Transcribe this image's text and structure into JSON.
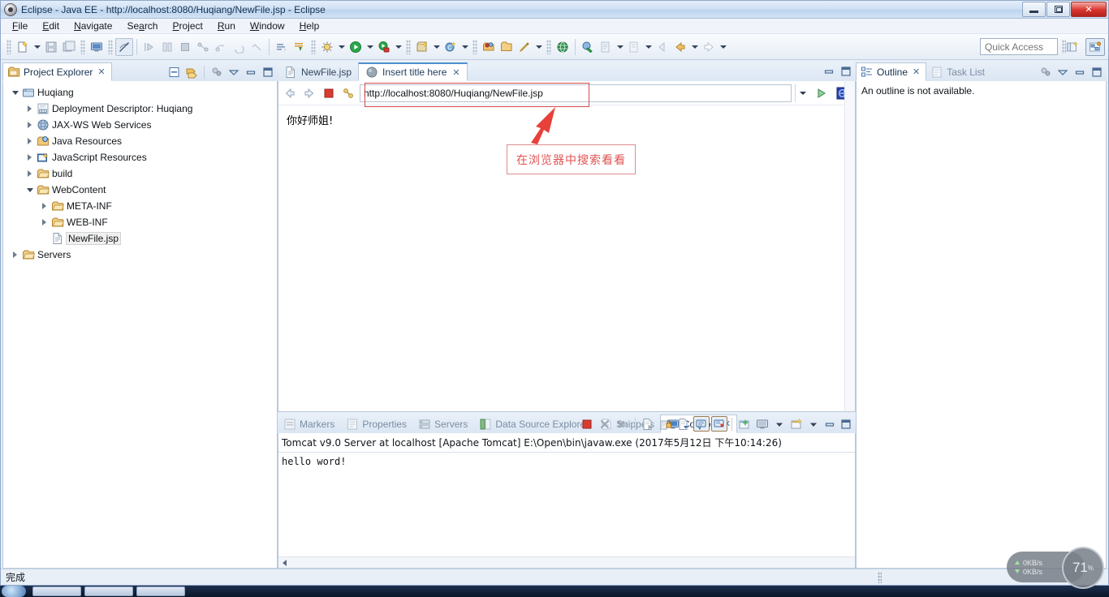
{
  "window": {
    "title": "Eclipse - Java EE - http://localhost:8080/Huqiang/NewFile.jsp - Eclipse",
    "app_icon": "eclipse-icon",
    "controls": {
      "minimize": "minimize",
      "restore": "restore",
      "close": "close"
    }
  },
  "menubar": {
    "items": [
      {
        "label": "File"
      },
      {
        "label": "Edit"
      },
      {
        "label": "Navigate"
      },
      {
        "label": "Search"
      },
      {
        "label": "Project"
      },
      {
        "label": "Run"
      },
      {
        "label": "Window"
      },
      {
        "label": "Help"
      }
    ]
  },
  "toolbar": {
    "quick_access_placeholder": "Quick Access",
    "quick_access_value": ""
  },
  "project_explorer": {
    "tab_label": "Project Explorer",
    "tab_close": "✕",
    "tree": [
      {
        "label": "Huqiang",
        "depth": 0,
        "state": "open",
        "icon": "project-icon"
      },
      {
        "label": "Deployment Descriptor: Huqiang",
        "depth": 1,
        "state": "closed",
        "icon": "deployment-descriptor-icon"
      },
      {
        "label": "JAX-WS Web Services",
        "depth": 1,
        "state": "closed",
        "icon": "jaxws-icon"
      },
      {
        "label": "Java Resources",
        "depth": 1,
        "state": "closed",
        "icon": "java-resources-icon"
      },
      {
        "label": "JavaScript Resources",
        "depth": 1,
        "state": "closed",
        "icon": "javascript-resources-icon"
      },
      {
        "label": "build",
        "depth": 1,
        "state": "closed",
        "icon": "folder-icon"
      },
      {
        "label": "WebContent",
        "depth": 1,
        "state": "open",
        "icon": "folder-icon"
      },
      {
        "label": "META-INF",
        "depth": 2,
        "state": "closed",
        "icon": "folder-icon"
      },
      {
        "label": "WEB-INF",
        "depth": 2,
        "state": "closed",
        "icon": "folder-icon"
      },
      {
        "label": "NewFile.jsp",
        "depth": 2,
        "state": "leaf",
        "icon": "file-icon",
        "selected": true
      },
      {
        "label": "Servers",
        "depth": 0,
        "state": "closed",
        "icon": "folder-icon"
      }
    ]
  },
  "editor": {
    "tabs": [
      {
        "label": "NewFile.jsp",
        "active": false,
        "icon": "jsp-file-icon",
        "closable": false
      },
      {
        "label": "Insert title here",
        "active": true,
        "icon": "globe-icon",
        "closable": true,
        "close": "✕"
      }
    ],
    "browser": {
      "back": "back-arrow",
      "forward": "forward-arrow",
      "stop": "stop-icon",
      "refresh": "refresh-icon",
      "url": "http://localhost:8080/Huqiang/NewFile.jsp",
      "go": "go-icon",
      "open_external": "open-external-icon"
    },
    "page_text": "你好师姐!",
    "annotation": {
      "text": "在浏览器中搜索看看",
      "color": "#e05353"
    }
  },
  "bottom_panel": {
    "tabs": [
      {
        "label": "Markers",
        "active": false,
        "icon": "markers-icon"
      },
      {
        "label": "Properties",
        "active": false,
        "icon": "properties-icon"
      },
      {
        "label": "Servers",
        "active": false,
        "icon": "servers-icon"
      },
      {
        "label": "Data Source Explorer",
        "active": false,
        "icon": "data-source-icon"
      },
      {
        "label": "Snippets",
        "active": false,
        "icon": "snippets-icon"
      },
      {
        "label": "Console",
        "active": true,
        "icon": "console-icon",
        "close": "✕"
      }
    ],
    "console_header": "Tomcat v9.0 Server at localhost [Apache Tomcat] E:\\Open\\bin\\javaw.exe (2017年5月12日 下午10:14:26)",
    "console_output": "hello word!"
  },
  "outline": {
    "tabs": [
      {
        "label": "Outline",
        "active": true,
        "icon": "outline-icon",
        "close": "✕"
      },
      {
        "label": "Task List",
        "active": false,
        "icon": "task-list-icon"
      }
    ],
    "message": "An outline is not available."
  },
  "statusbar": {
    "text": "完成"
  },
  "monitor_widget": {
    "upload": "0KB/s",
    "download": "0KB/s",
    "cpu": "71",
    "cpu_unit": "%"
  },
  "colors": {
    "accent": "#4f8fd0",
    "annotation_red": "#e05353",
    "close_red": "#d9352c",
    "titlebar": "#cfe0f4"
  }
}
